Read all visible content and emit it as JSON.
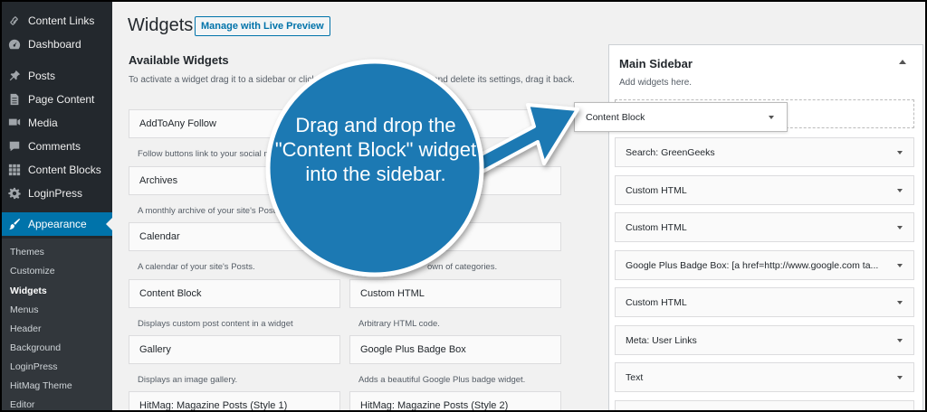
{
  "colors": {
    "admin_bg": "#23282d",
    "accent": "#0073aa",
    "bubble": "#1f79b3"
  },
  "menu": {
    "items": [
      {
        "label": "Content Links",
        "icon": "link-icon"
      },
      {
        "label": "Dashboard",
        "icon": "dashboard-icon"
      },
      {
        "label": "Posts",
        "icon": "pin-icon"
      },
      {
        "label": "Page Content",
        "icon": "page-icon"
      },
      {
        "label": "Media",
        "icon": "media-icon"
      },
      {
        "label": "Comments",
        "icon": "comment-icon"
      },
      {
        "label": "Content Blocks",
        "icon": "grid-icon"
      },
      {
        "label": "LoginPress",
        "icon": "gear-icon"
      },
      {
        "label": "Appearance",
        "icon": "brush-icon"
      }
    ],
    "submenu": [
      "Themes",
      "Customize",
      "Widgets",
      "Menus",
      "Header",
      "Background",
      "LoginPress",
      "HitMag Theme",
      "Editor"
    ]
  },
  "header": {
    "title": "Widgets",
    "live_preview": "Manage with Live Preview"
  },
  "available": {
    "title": "Available Widgets",
    "description": "To activate a widget drag it to a sidebar or click on it. To deactivate a widget and delete its settings, drag it back.",
    "widgets": [
      {
        "name": "AddToAny Follow",
        "desc": "Follow buttons link to your social media."
      },
      {
        "name": "Archives",
        "desc": "A monthly archive of your site's Posts."
      },
      {
        "name": "Calendar",
        "desc": "A calendar of your site's Posts."
      },
      {
        "name": "Content Block",
        "desc": "Displays custom post content in a widget"
      },
      {
        "name": "Custom HTML",
        "desc": "Arbitrary HTML code."
      },
      {
        "name": "Gallery",
        "desc": "Displays an image gallery."
      },
      {
        "name": "Google Plus Badge Box",
        "desc": "Adds a beautiful Google Plus badge widget."
      },
      {
        "name": "HitMag: Magazine Posts (Style 1)",
        "desc": ""
      },
      {
        "name": "HitMag: Magazine Posts (Style 2)",
        "desc": ""
      },
      {
        "name": "",
        "desc": "own of categories."
      }
    ]
  },
  "sidebar": {
    "title": "Main Sidebar",
    "description": "Add widgets here.",
    "dragged": "Content Block",
    "items": [
      "Search: GreenGeeks",
      "Custom HTML",
      "Custom HTML",
      "Google Plus Badge Box: [a href=http://www.google.com ta...",
      "Custom HTML",
      "Meta: User Links",
      "Text"
    ]
  },
  "callout": {
    "text": "Drag and drop the \"Content Block\" widget into the sidebar."
  }
}
